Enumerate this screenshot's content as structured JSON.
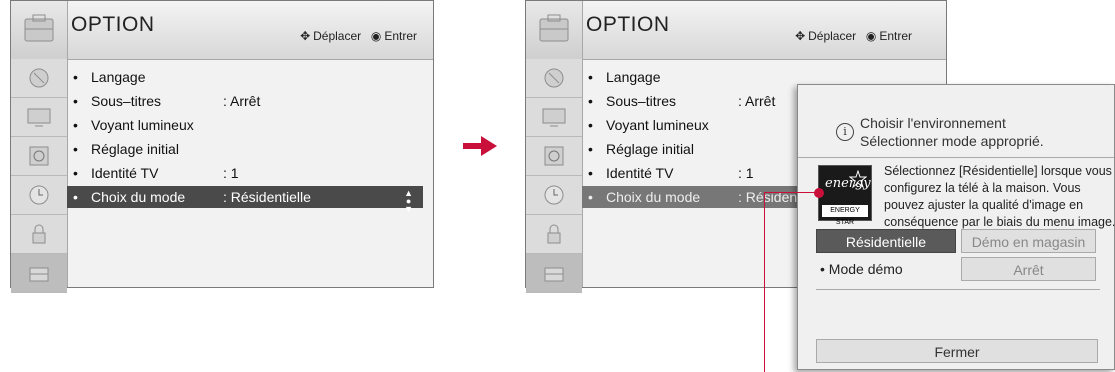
{
  "menu": {
    "title": "OPTION",
    "hint_move": "Déplacer",
    "hint_enter": "Entrer",
    "items": [
      {
        "label": "Langage",
        "value": ""
      },
      {
        "label": "Sous–titres",
        "value": ": Arrêt"
      },
      {
        "label": "Voyant lumineux",
        "value": ""
      },
      {
        "label": "Réglage initial",
        "value": ""
      },
      {
        "label": "Identité TV",
        "value": ": 1"
      },
      {
        "label": "Choix du mode",
        "value": ": Résidentielle"
      }
    ],
    "right_selected_value": ": Résidentie"
  },
  "sidebar_icons": [
    "satellite-dish-icon",
    "tv-screen-icon",
    "speaker-icon",
    "clock-icon",
    "lock-icon",
    "toolbox-icon"
  ],
  "popup": {
    "title_line1": "Choisir l'environnement",
    "title_line2": "Sélectionner mode approprié.",
    "info_glyph": "i",
    "logo_text": "energy",
    "logo_caption": "ENERGY STAR",
    "description": "Sélectionnez [Résidentielle] lorsque vous configurez la télé à la maison. Vous pouvez ajuster la qualité d'image en conséquence par le biais du menu image.",
    "btn_residential": "Résidentielle",
    "btn_store_demo": "Démo en magasin",
    "demo_mode_label": "• Mode démo",
    "btn_off": "Arrêt",
    "btn_close": "Fermer"
  },
  "colors": {
    "accent": "#c8103a",
    "selected_row": "#4a4a4a",
    "panel_bg": "#f2f2f2"
  }
}
